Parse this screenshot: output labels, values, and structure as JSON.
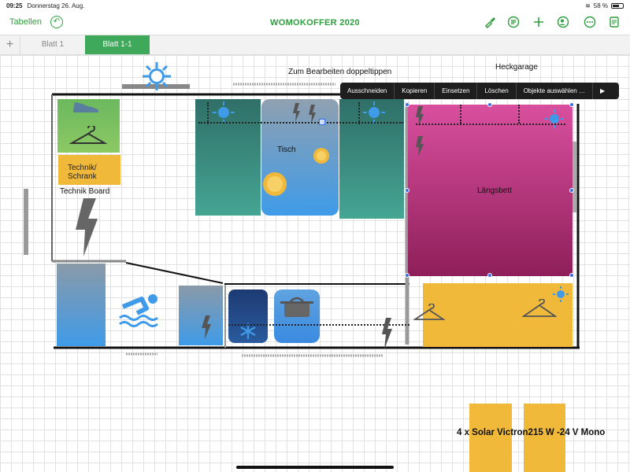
{
  "status": {
    "time": "09:25",
    "date": "Donnerstag 26. Aug.",
    "battery": "58 %",
    "battery_level": 0.58
  },
  "toolbar": {
    "back_label": "Tabellen",
    "title": "WOMOKOFFER 2020",
    "icons": [
      "undo-icon",
      "paintbrush-icon",
      "format-icon",
      "add-icon",
      "collaborate-icon",
      "more-icon",
      "document-icon"
    ]
  },
  "tabs": [
    {
      "label": "Blatt 1",
      "active": false
    },
    {
      "label": "Blatt 1-1",
      "active": true
    }
  ],
  "canvas": {
    "edit_hint": "Zum Bearbeiten doppeltippen",
    "heckgarage": "Heckgarage",
    "technik_schrank": "Technik/\nSchrank",
    "technik_board": "Technik Board",
    "tisch": "Tisch",
    "laengsbett": "Längsbett",
    "solar": "4 x Solar Victron215 W -24 V Mono"
  },
  "context_menu": [
    "Ausschneiden",
    "Kopieren",
    "Einsetzen",
    "Löschen",
    "Objekte auswählen …",
    "▶"
  ],
  "colors": {
    "accent": "#2e9e3e",
    "tab_active": "#3fa95b",
    "teal": "#3aa08c",
    "pink": "#c8468e",
    "yellow": "#f0b93a",
    "blue": "#3f9be8",
    "navy": "#1f3e7a"
  }
}
